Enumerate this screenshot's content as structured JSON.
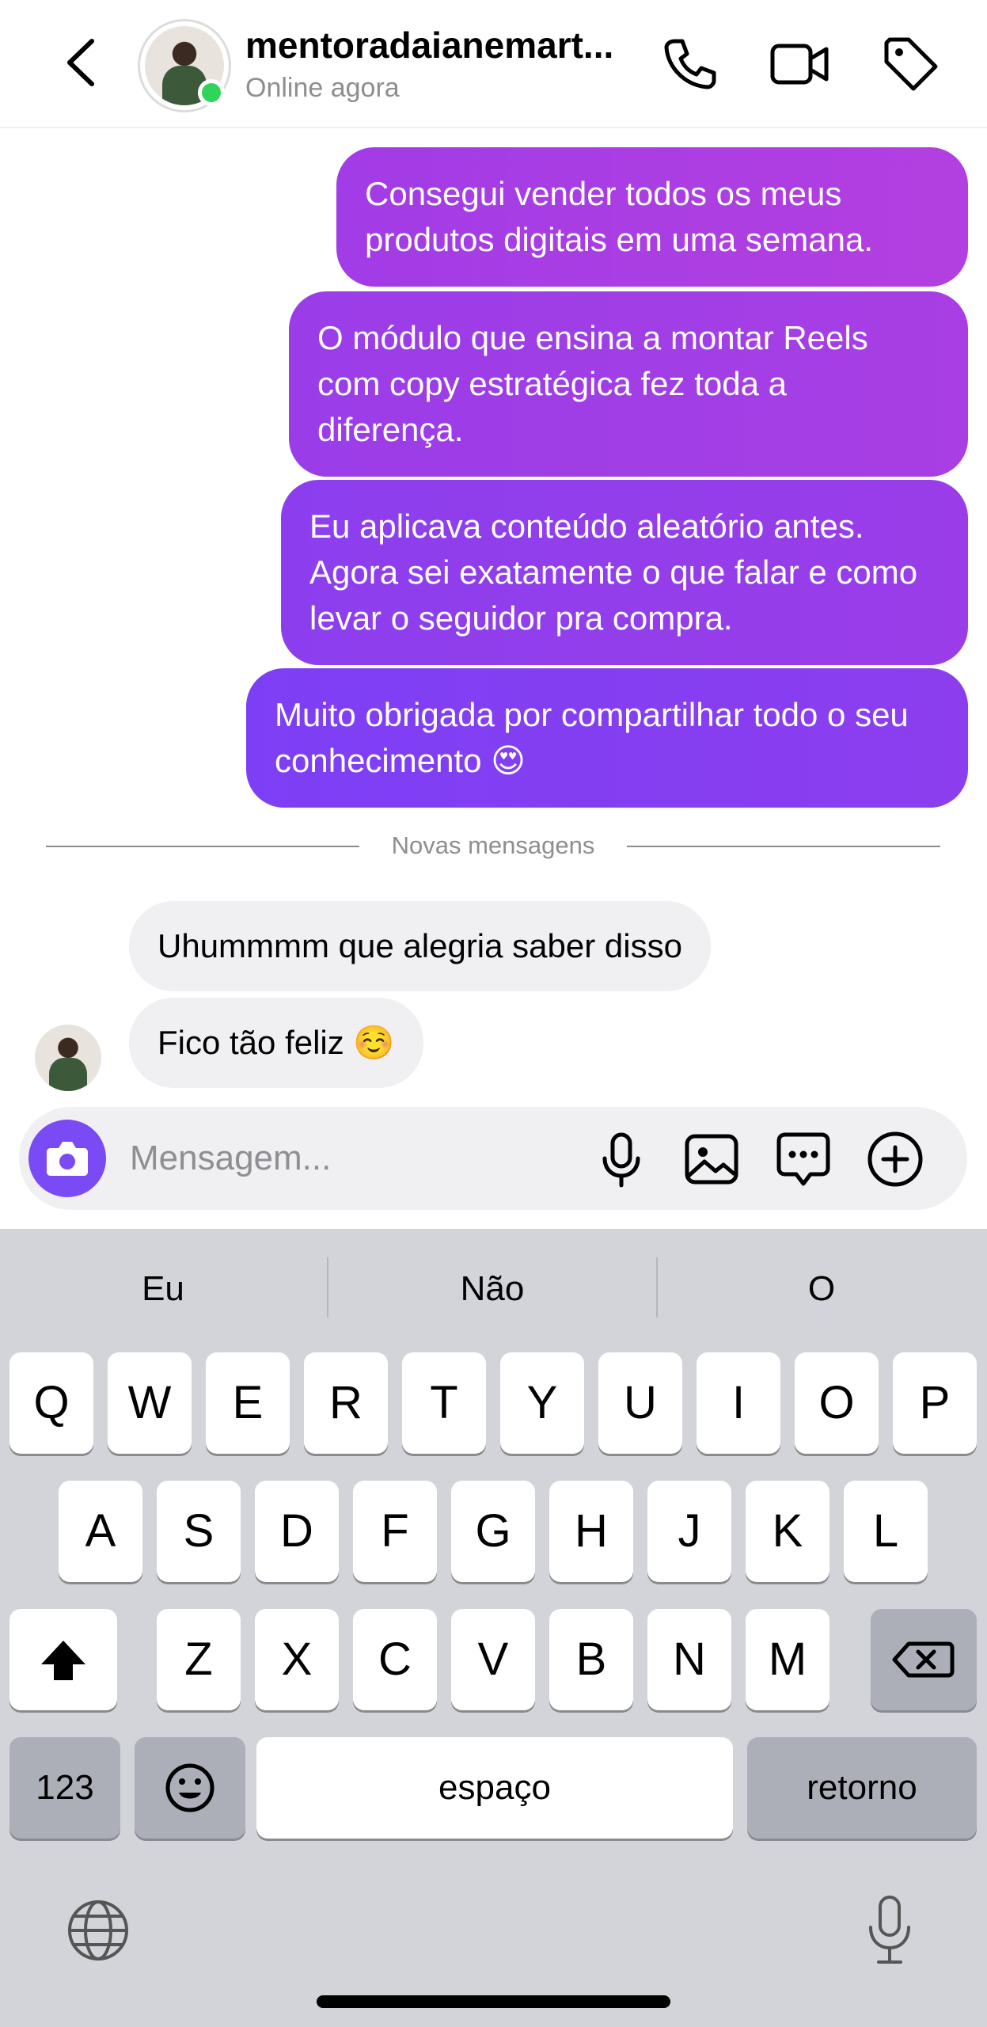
{
  "header": {
    "contact_name": "mentoradaianemart...",
    "status": "Online agora",
    "icons": [
      "back-chevron-icon",
      "phone-icon",
      "video-icon",
      "tag-icon"
    ]
  },
  "colors": {
    "outgoing_gradient_start": "#b33fe0",
    "outgoing_gradient_end": "#7d3ff5",
    "incoming_bubble": "#f0f0f2",
    "online": "#2fd45b",
    "camera_button": "#7a4bf5"
  },
  "messages": {
    "outgoing": [
      "Consegui vender todos os meus produtos digitais em uma semana.",
      "O módulo que ensina a montar Reels com copy estratégica fez toda a diferença.",
      "Eu aplicava conteúdo aleatório antes. Agora sei exatamente o que falar e como levar o seguidor pra compra.",
      "Muito obrigada por compartilhar todo o seu conhecimento 😍"
    ],
    "divider_label": "Novas mensagens",
    "incoming": [
      "Uhummmm que alegria saber disso",
      "Fico tão feliz ☺️"
    ]
  },
  "composer": {
    "placeholder": "Mensagem...",
    "icons": [
      "camera-icon",
      "microphone-icon",
      "gallery-icon",
      "sticker-icon",
      "plus-icon"
    ]
  },
  "keyboard": {
    "suggestions": [
      "Eu",
      "Não",
      "O"
    ],
    "row1": [
      "Q",
      "W",
      "E",
      "R",
      "T",
      "Y",
      "U",
      "I",
      "O",
      "P"
    ],
    "row2": [
      "A",
      "S",
      "D",
      "F",
      "G",
      "H",
      "J",
      "K",
      "L"
    ],
    "row3": [
      "Z",
      "X",
      "C",
      "V",
      "B",
      "N",
      "M"
    ],
    "numbers_key": "123",
    "space_key": "espaço",
    "return_key": "retorno"
  }
}
